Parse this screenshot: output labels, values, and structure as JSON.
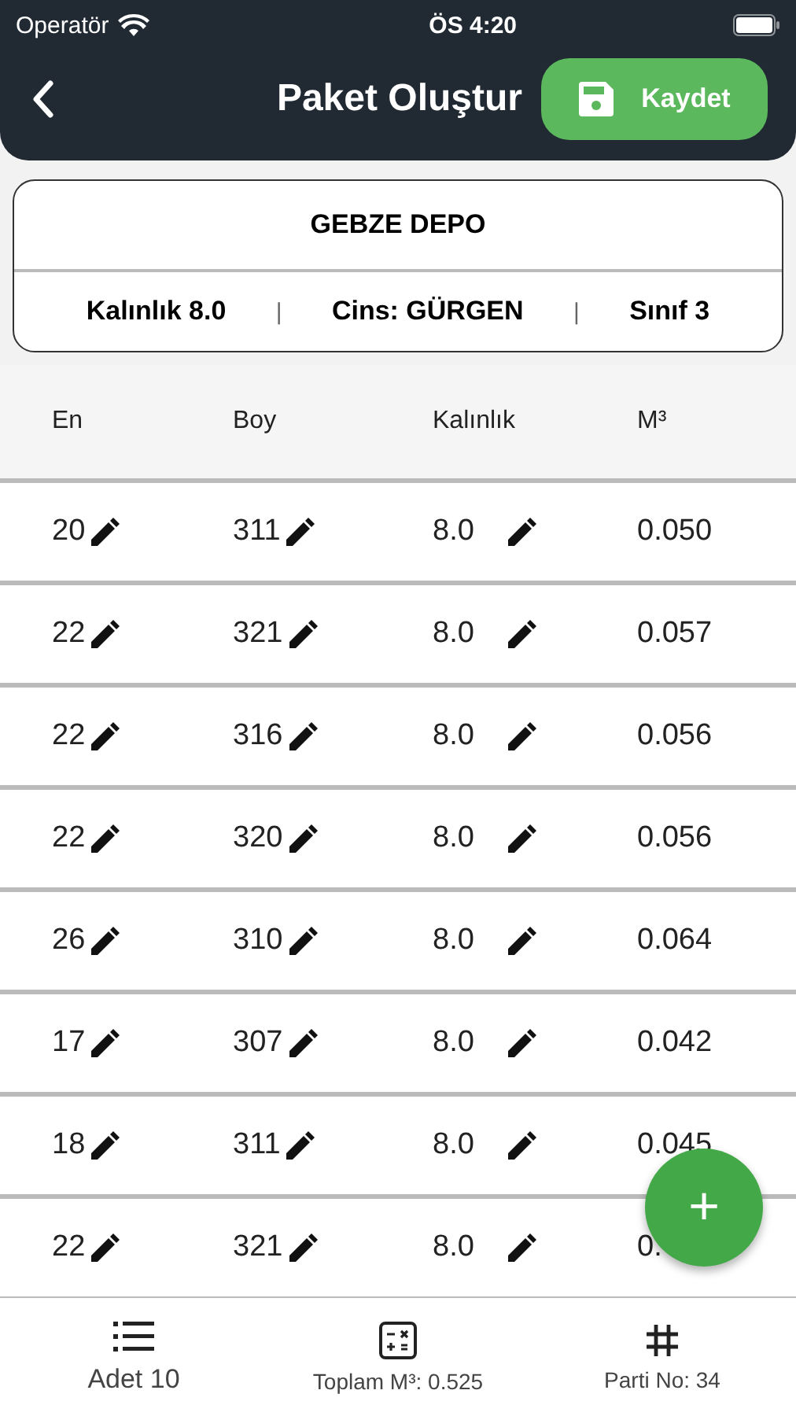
{
  "status_bar": {
    "carrier": "Operatör",
    "time": "ÖS 4:20"
  },
  "header": {
    "title": "Paket Oluştur",
    "save_button": "Kaydet"
  },
  "info_card": {
    "title": "GEBZE DEPO",
    "details": [
      "Kalınlık 8.0",
      "Cins: GÜRGEN",
      "Sınıf 3"
    ],
    "separators": [
      "|",
      "|"
    ]
  },
  "table": {
    "columns": [
      "En",
      "Boy",
      "Kalınlık",
      "M³"
    ],
    "rows": [
      {
        "en": "20",
        "boy": "311",
        "kalinlik": "8.0",
        "m3": "0.050"
      },
      {
        "en": "22",
        "boy": "321",
        "kalinlik": "8.0",
        "m3": "0.057"
      },
      {
        "en": "22",
        "boy": "316",
        "kalinlik": "8.0",
        "m3": "0.056"
      },
      {
        "en": "22",
        "boy": "320",
        "kalinlik": "8.0",
        "m3": "0.056"
      },
      {
        "en": "26",
        "boy": "310",
        "kalinlik": "8.0",
        "m3": "0.064"
      },
      {
        "en": "17",
        "boy": "307",
        "kalinlik": "8.0",
        "m3": "0.042"
      },
      {
        "en": "18",
        "boy": "311",
        "kalinlik": "8.0",
        "m3": "0.045"
      },
      {
        "en": "22",
        "boy": "321",
        "kalinlik": "8.0",
        "m3": "0."
      }
    ]
  },
  "fab": {
    "label": "+"
  },
  "bottom_bar": [
    {
      "kind": "list",
      "label": "Adet 10"
    },
    {
      "kind": "calculator",
      "label": "Toplam M³: 0.525"
    },
    {
      "kind": "hash",
      "label": "Parti No: 34"
    }
  ]
}
